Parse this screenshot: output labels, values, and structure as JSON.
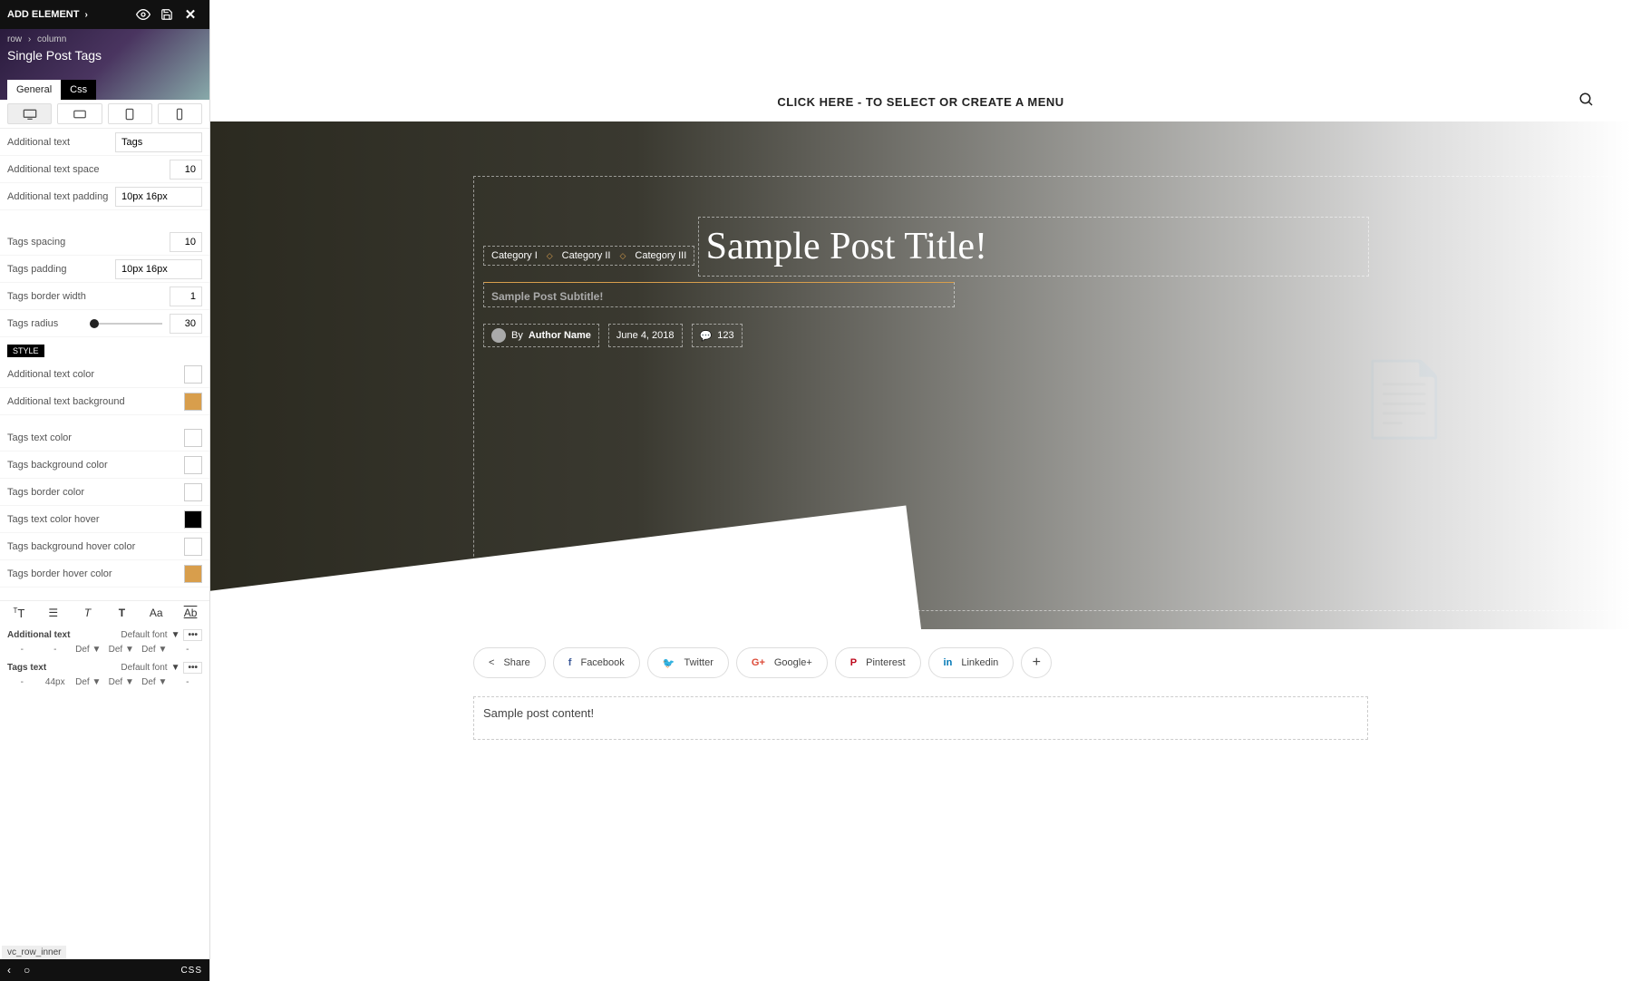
{
  "topbar": {
    "add_element": "ADD ELEMENT"
  },
  "breadcrumb": {
    "item1": "row",
    "item2": "column"
  },
  "element_title": "Single Post Tags",
  "tabs": {
    "general": "General",
    "css": "Css"
  },
  "fields": {
    "additional_text_label": "Additional text",
    "additional_text_value": "Tags",
    "additional_text_space_label": "Additional text space",
    "additional_text_space_value": "10",
    "additional_text_padding_label": "Additional text padding",
    "additional_text_padding_value": "10px 16px",
    "tags_spacing_label": "Tags spacing",
    "tags_spacing_value": "10",
    "tags_padding_label": "Tags padding",
    "tags_padding_value": "10px 16px",
    "tags_border_width_label": "Tags border width",
    "tags_border_width_value": "1",
    "tags_radius_label": "Tags radius",
    "tags_radius_value": "30"
  },
  "style_label": "STYLE",
  "colors": {
    "additional_text_color": "Additional text color",
    "additional_text_background": "Additional text background",
    "tags_text_color": "Tags text color",
    "tags_background_color": "Tags background color",
    "tags_border_color": "Tags border color",
    "tags_text_color_hover": "Tags text color hover",
    "tags_background_hover_color": "Tags background hover color",
    "tags_border_hover_color": "Tags border hover color"
  },
  "typo": {
    "head1_label": "Additional text",
    "head1_font": "Default font",
    "row1": {
      "a": "-",
      "b": "-",
      "c": "Def",
      "ca": "▼",
      "d": "Def",
      "da": "▼",
      "e": "Def",
      "ea": "▼",
      "f": "-"
    },
    "head2_label": "Tags text",
    "head2_font": "Default font",
    "row2": {
      "a": "-",
      "b": "44px",
      "c": "Def",
      "ca": "▼",
      "d": "Def",
      "da": "▼",
      "e": "Def",
      "ea": "▼",
      "f": "-"
    }
  },
  "inner_label": "vc_row_inner",
  "bottom": {
    "css": "CSS"
  },
  "preview": {
    "menu_cta": "CLICK HERE - TO SELECT OR CREATE A MENU",
    "categories": [
      "Category I",
      "Category II",
      "Category III"
    ],
    "title": "Sample Post Title!",
    "subtitle": "Sample Post Subtitle!",
    "by": "By",
    "author": "Author Name",
    "date": "June 4, 2018",
    "comments": "123",
    "share": "Share",
    "facebook": "Facebook",
    "twitter": "Twitter",
    "google": "Google+",
    "pinterest": "Pinterest",
    "linkedin": "Linkedin",
    "content": "Sample post content!"
  }
}
